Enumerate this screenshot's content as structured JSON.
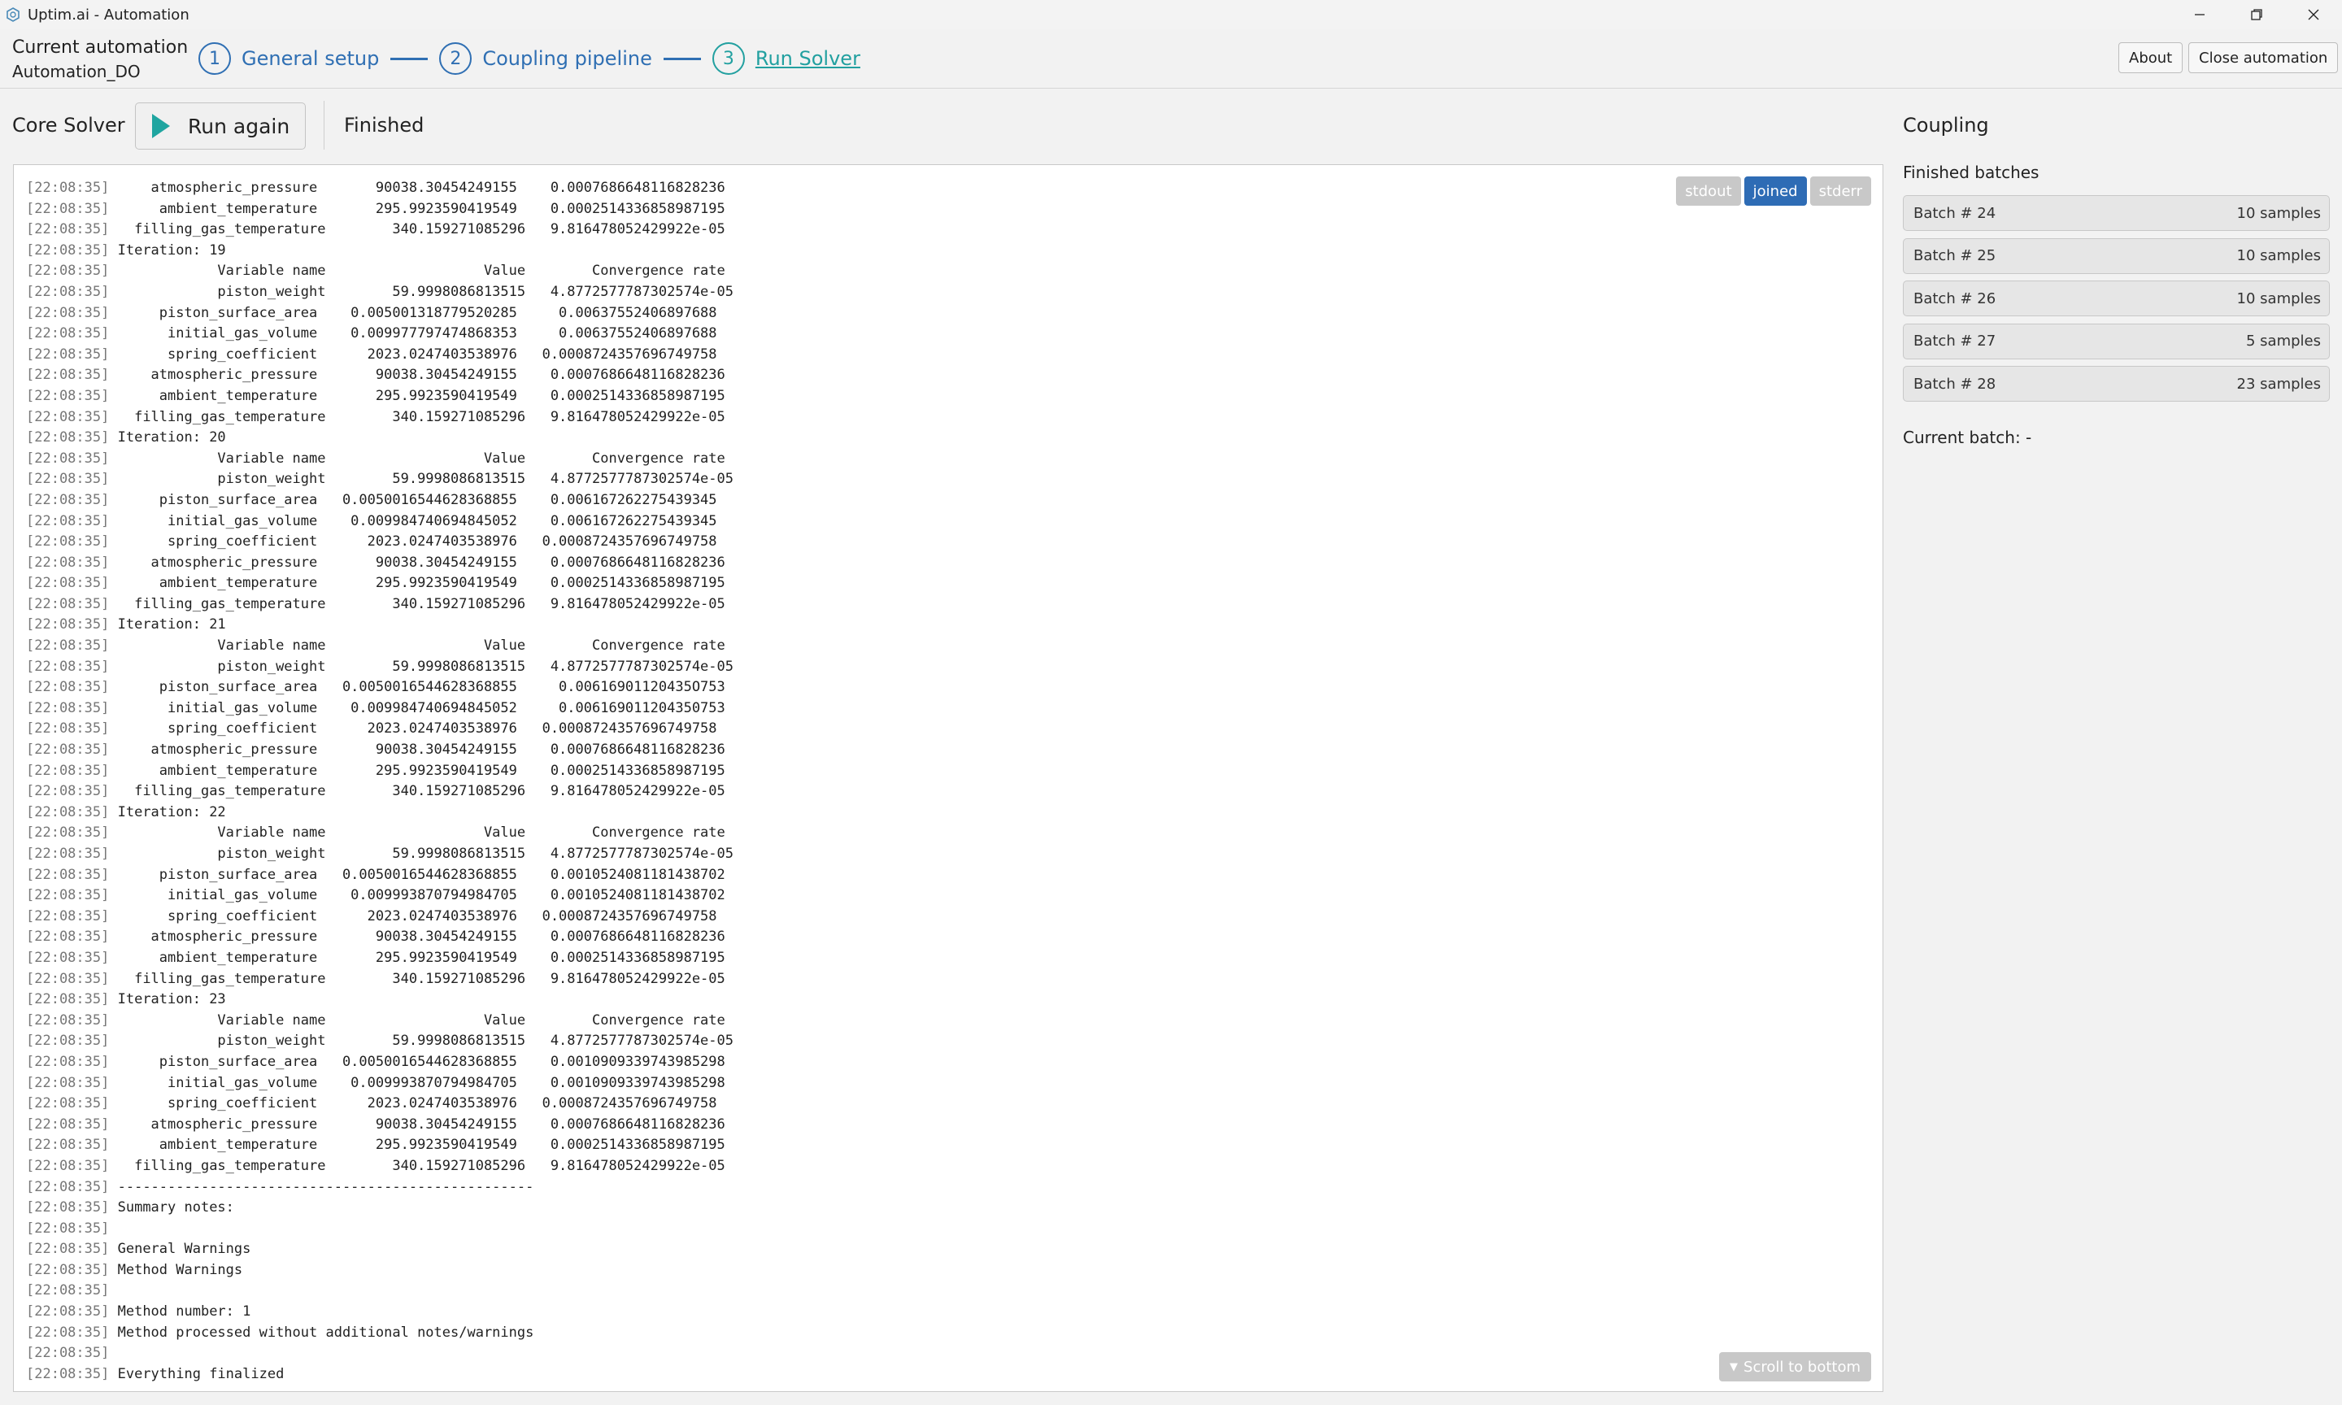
{
  "window": {
    "title": "Uptim.ai - Automation"
  },
  "header": {
    "current_automation_label": "Current automation",
    "current_automation_value": "Automation_DO",
    "steps": [
      {
        "number": "1",
        "label": "General setup"
      },
      {
        "number": "2",
        "label": "Coupling pipeline"
      },
      {
        "number": "3",
        "label": "Run Solver"
      }
    ],
    "about_label": "About",
    "close_label": "Close automation"
  },
  "solver": {
    "title": "Core Solver",
    "run_again_label": "Run again",
    "status": "Finished"
  },
  "log": {
    "filters": [
      "stdout",
      "joined",
      "stderr"
    ],
    "active_filter": "joined",
    "scroll_bottom_label": "Scroll to bottom",
    "lines": [
      {
        "ts": "[22:08:35]",
        "text": "    atmospheric_pressure       90038.30454249155    0.0007686648116828236"
      },
      {
        "ts": "[22:08:35]",
        "text": "     ambient_temperature       295.9923590419549    0.0002514336858987195"
      },
      {
        "ts": "[22:08:35]",
        "text": "  filling_gas_temperature        340.159271085296   9.816478052429922e-05"
      },
      {
        "ts": "[22:08:35]",
        "text": "Iteration: 19"
      },
      {
        "ts": "[22:08:35]",
        "text": "            Variable name                   Value        Convergence rate"
      },
      {
        "ts": "[22:08:35]",
        "text": "            piston_weight        59.9998086813515   4.8772577787302574e-05"
      },
      {
        "ts": "[22:08:35]",
        "text": "     piston_surface_area    0.005001318779520285     0.00637552406897688"
      },
      {
        "ts": "[22:08:35]",
        "text": "      initial_gas_volume    0.009977797474868353     0.00637552406897688"
      },
      {
        "ts": "[22:08:35]",
        "text": "      spring_coefficient      2023.0247403538976   0.0008724357696749758"
      },
      {
        "ts": "[22:08:35]",
        "text": "    atmospheric_pressure       90038.30454249155    0.0007686648116828236"
      },
      {
        "ts": "[22:08:35]",
        "text": "     ambient_temperature       295.9923590419549    0.0002514336858987195"
      },
      {
        "ts": "[22:08:35]",
        "text": "  filling_gas_temperature        340.159271085296   9.816478052429922e-05"
      },
      {
        "ts": "[22:08:35]",
        "text": "Iteration: 20"
      },
      {
        "ts": "[22:08:35]",
        "text": "            Variable name                   Value        Convergence rate"
      },
      {
        "ts": "[22:08:35]",
        "text": "            piston_weight        59.9998086813515   4.8772577787302574e-05"
      },
      {
        "ts": "[22:08:35]",
        "text": "     piston_surface_area   0.0050016544628368855    0.006167262275439345"
      },
      {
        "ts": "[22:08:35]",
        "text": "      initial_gas_volume    0.009984740694845052    0.006167262275439345"
      },
      {
        "ts": "[22:08:35]",
        "text": "      spring_coefficient      2023.0247403538976   0.0008724357696749758"
      },
      {
        "ts": "[22:08:35]",
        "text": "    atmospheric_pressure       90038.30454249155    0.0007686648116828236"
      },
      {
        "ts": "[22:08:35]",
        "text": "     ambient_temperature       295.9923590419549    0.0002514336858987195"
      },
      {
        "ts": "[22:08:35]",
        "text": "  filling_gas_temperature        340.159271085296   9.816478052429922e-05"
      },
      {
        "ts": "[22:08:35]",
        "text": "Iteration: 21"
      },
      {
        "ts": "[22:08:35]",
        "text": "            Variable name                   Value        Convergence rate"
      },
      {
        "ts": "[22:08:35]",
        "text": "            piston_weight        59.9998086813515   4.8772577787302574e-05"
      },
      {
        "ts": "[22:08:35]",
        "text": "     piston_surface_area   0.0050016544628368855     0.00616901120435O753"
      },
      {
        "ts": "[22:08:35]",
        "text": "      initial_gas_volume    0.009984740694845052     0.006169011204350753"
      },
      {
        "ts": "[22:08:35]",
        "text": "      spring_coefficient      2023.0247403538976   0.0008724357696749758"
      },
      {
        "ts": "[22:08:35]",
        "text": "    atmospheric_pressure       90038.30454249155    0.0007686648116828236"
      },
      {
        "ts": "[22:08:35]",
        "text": "     ambient_temperature       295.9923590419549    0.0002514336858987195"
      },
      {
        "ts": "[22:08:35]",
        "text": "  filling_gas_temperature        340.159271085296   9.816478052429922e-05"
      },
      {
        "ts": "[22:08:35]",
        "text": "Iteration: 22"
      },
      {
        "ts": "[22:08:35]",
        "text": "            Variable name                   Value        Convergence rate"
      },
      {
        "ts": "[22:08:35]",
        "text": "            piston_weight        59.9998086813515   4.8772577787302574e-05"
      },
      {
        "ts": "[22:08:35]",
        "text": "     piston_surface_area   0.0050016544628368855    0.001052408118143​8702"
      },
      {
        "ts": "[22:08:35]",
        "text": "      initial_gas_volume    0.009993870794984705    0.0010524081181438702"
      },
      {
        "ts": "[22:08:35]",
        "text": "      spring_coefficient      2023.0247403538976   0.0008724357696749758"
      },
      {
        "ts": "[22:08:35]",
        "text": "    atmospheric_pressure       90038.30454249155    0.0007686648116828236"
      },
      {
        "ts": "[22:08:35]",
        "text": "     ambient_temperature       295.9923590419549    0.0002514336858987195"
      },
      {
        "ts": "[22:08:35]",
        "text": "  filling_gas_temperature        340.159271085296   9.816478052429922e-05"
      },
      {
        "ts": "[22:08:35]",
        "text": "Iteration: 23"
      },
      {
        "ts": "[22:08:35]",
        "text": "            Variable name                   Value        Convergence rate"
      },
      {
        "ts": "[22:08:35]",
        "text": "            piston_weight        59.9998086813515   4.8772577787302574e-05"
      },
      {
        "ts": "[22:08:35]",
        "text": "     piston_surface_area   0.0050016544628368855    0.0010909339743985298"
      },
      {
        "ts": "[22:08:35]",
        "text": "      initial_gas_volume    0.009993870794984705    0.0010909339743985298"
      },
      {
        "ts": "[22:08:35]",
        "text": "      spring_coefficient      2023.0247403538976   0.0008724357696749758"
      },
      {
        "ts": "[22:08:35]",
        "text": "    atmospheric_pressure       90038.30454249155    0.0007686648116828236"
      },
      {
        "ts": "[22:08:35]",
        "text": "     ambient_temperature       295.9923590419549    0.0002514336858987195"
      },
      {
        "ts": "[22:08:35]",
        "text": "  filling_gas_temperature        340.159271085296   9.816478052429922e-05"
      },
      {
        "ts": "[22:08:35]",
        "text": "--------------------------------------------------"
      },
      {
        "ts": "[22:08:35]",
        "text": "Summary notes:"
      },
      {
        "ts": "[22:08:35]",
        "text": ""
      },
      {
        "ts": "[22:08:35]",
        "text": "General Warnings"
      },
      {
        "ts": "[22:08:35]",
        "text": "Method Warnings"
      },
      {
        "ts": "[22:08:35]",
        "text": ""
      },
      {
        "ts": "[22:08:35]",
        "text": "Method number: 1"
      },
      {
        "ts": "[22:08:35]",
        "text": "Method processed without additional notes/warnings"
      },
      {
        "ts": "[22:08:35]",
        "text": ""
      },
      {
        "ts": "[22:08:35]",
        "text": "Everything finalized"
      }
    ]
  },
  "coupling": {
    "title": "Coupling",
    "finished_batches_label": "Finished batches",
    "batches": [
      {
        "name": "Batch # 24",
        "samples": "10 samples"
      },
      {
        "name": "Batch # 25",
        "samples": "10 samples"
      },
      {
        "name": "Batch # 26",
        "samples": "10 samples"
      },
      {
        "name": "Batch # 27",
        "samples": "5 samples"
      },
      {
        "name": "Batch # 28",
        "samples": "23 samples"
      }
    ],
    "current_batch": "Current batch: -"
  },
  "colors": {
    "accent": "#2f6fb3",
    "active_step": "#22a0a0",
    "play": "#1fa5a0",
    "toggle_active": "#2e6cb5",
    "toggle_inactive": "#c8c8c8"
  }
}
